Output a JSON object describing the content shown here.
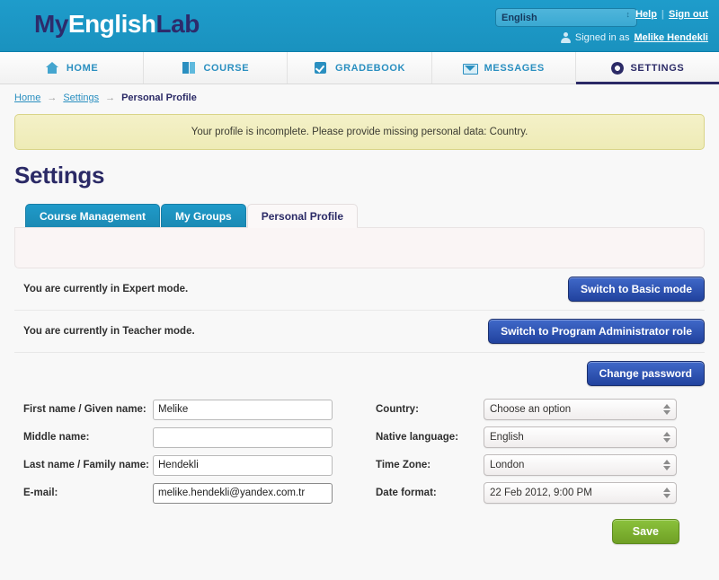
{
  "header": {
    "logo": {
      "part1": "My",
      "part2": "English",
      "part3": "Lab"
    },
    "language_select": {
      "value": "English",
      "icon": "spinner-arrows-icon"
    },
    "help_label": "Help",
    "separator": "|",
    "signout_label": "Sign out",
    "signed_in_prefix": "Signed in as",
    "user_name": "Melike Hendekli",
    "user_icon": "user-icon"
  },
  "nav": {
    "items": [
      {
        "label": "HOME",
        "icon": "home-icon",
        "active": false
      },
      {
        "label": "COURSE",
        "icon": "book-icon",
        "active": false
      },
      {
        "label": "GRADEBOOK",
        "icon": "checkbox-icon",
        "active": false
      },
      {
        "label": "MESSAGES",
        "icon": "envelope-icon",
        "active": false
      },
      {
        "label": "SETTINGS",
        "icon": "gear-icon",
        "active": true
      }
    ]
  },
  "breadcrumb": {
    "home": "Home",
    "arrow": "→",
    "settings": "Settings",
    "current": "Personal Profile"
  },
  "alert": {
    "message": "Your profile is incomplete. Please provide missing personal data: Country."
  },
  "page_title": "Settings",
  "tabs": [
    {
      "label": "Course Management",
      "active": false
    },
    {
      "label": "My Groups",
      "active": false
    },
    {
      "label": "Personal Profile",
      "active": true
    }
  ],
  "mode_rows": [
    {
      "text": "You are currently in Expert mode.",
      "button": "Switch to Basic mode"
    },
    {
      "text": "You are currently in Teacher mode.",
      "button": "Switch to Program Administrator role"
    }
  ],
  "change_password_label": "Change password",
  "form": {
    "left": [
      {
        "label": "First name / Given name:",
        "value": "Melike",
        "type": "text",
        "focused": false
      },
      {
        "label": "Middle name:",
        "value": "",
        "type": "text",
        "focused": false
      },
      {
        "label": "Last name / Family name:",
        "value": "Hendekli",
        "type": "text",
        "focused": false
      },
      {
        "label": "E-mail:",
        "value": "melike.hendekli@yandex.com.tr",
        "type": "text",
        "focused": true
      }
    ],
    "right": [
      {
        "label": "Country:",
        "value": "Choose an option",
        "type": "select"
      },
      {
        "label": "Native language:",
        "value": "English",
        "type": "select"
      },
      {
        "label": "Time Zone:",
        "value": "London",
        "type": "select"
      },
      {
        "label": "Date format:",
        "value": "22 Feb 2012, 9:00 PM",
        "type": "select"
      }
    ]
  },
  "save_label": "Save",
  "colors": {
    "header_blue": "#1c97c4",
    "nav_link_blue": "#2a8fc0",
    "brand_navy": "#2b2a66",
    "alert_yellow": "#f2efc2",
    "button_blue": "#21429e",
    "button_green": "#7cb22f",
    "panel_pink": "#faf5f5"
  }
}
